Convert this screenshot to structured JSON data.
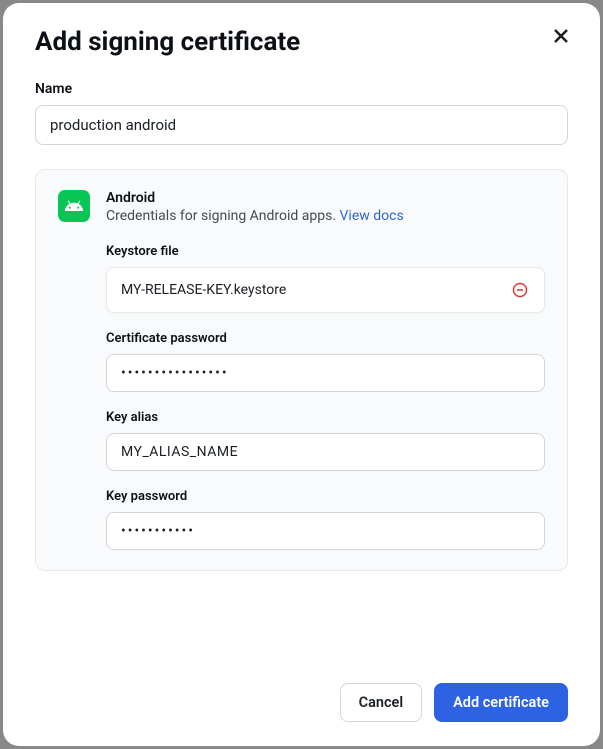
{
  "modal": {
    "title": "Add signing certificate",
    "name_label": "Name",
    "name_value": "production android"
  },
  "android": {
    "title": "Android",
    "description": "Credentials for signing Android apps. ",
    "docs_link": "View docs",
    "keystore_label": "Keystore file",
    "keystore_filename": "MY-RELEASE-KEY.keystore",
    "cert_password_label": "Certificate password",
    "cert_password_value": "mysecretpassword",
    "key_alias_label": "Key alias",
    "key_alias_value": "MY_ALIAS_NAME",
    "key_password_label": "Key password",
    "key_password_value": "anotherpass"
  },
  "footer": {
    "cancel_label": "Cancel",
    "submit_label": "Add certificate"
  }
}
